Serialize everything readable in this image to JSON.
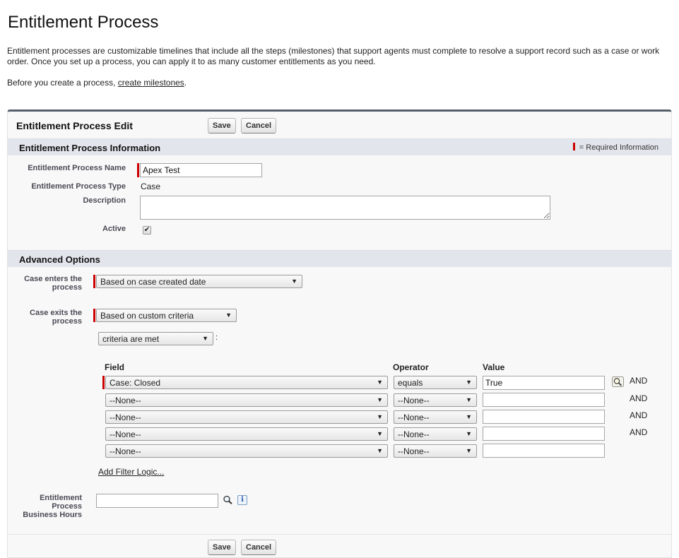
{
  "page": {
    "title": "Entitlement Process",
    "intro": "Entitlement processes are customizable timelines that include all the steps (milestones) that support agents must complete to resolve a support record such as a case or work order. Once you set up a process, you can apply it to as many customer entitlements as you need.",
    "before_prefix": "Before you create a process, ",
    "before_link": "create milestones",
    "before_suffix": "."
  },
  "edit": {
    "title": "Entitlement Process Edit",
    "save_label": "Save",
    "cancel_label": "Cancel"
  },
  "info_section": {
    "title": "Entitlement Process Information",
    "required_legend": "= Required Information",
    "name_label": "Entitlement Process Name",
    "name_value": "Apex Test",
    "type_label": "Entitlement Process Type",
    "type_value": "Case",
    "description_label": "Description",
    "description_value": "",
    "active_label": "Active",
    "active_checked": true
  },
  "advanced": {
    "title": "Advanced Options",
    "enters_label_1": "Case enters the",
    "enters_label_2": "process",
    "enters_value": "Based on case created date",
    "exits_label_1": "Case exits the",
    "exits_label_2": "process",
    "exits_value": "Based on custom criteria",
    "criteria_value": "criteria are met",
    "criteria_colon": ":",
    "columns": {
      "field": "Field",
      "operator": "Operator",
      "value": "Value"
    },
    "rows": [
      {
        "field": "Case: Closed",
        "operator": "equals",
        "value": "True",
        "and": "AND"
      },
      {
        "field": "--None--",
        "operator": "--None--",
        "value": "",
        "and": "AND"
      },
      {
        "field": "--None--",
        "operator": "--None--",
        "value": "",
        "and": "AND"
      },
      {
        "field": "--None--",
        "operator": "--None--",
        "value": "",
        "and": "AND"
      },
      {
        "field": "--None--",
        "operator": "--None--",
        "value": "",
        "and": ""
      }
    ],
    "add_filter_logic": "Add Filter Logic...",
    "bh_label_1": "Entitlement",
    "bh_label_2": "Process",
    "bh_label_3": "Business Hours",
    "bh_value": "",
    "info_glyph": "i"
  },
  "colors": {
    "required": "#cc0000",
    "section_bg": "#e2e6ec",
    "panel_border": "#56606b"
  },
  "icons": {
    "lookup": "lookup-icon",
    "info": "info-icon",
    "check": "✔",
    "caret": "▼"
  }
}
